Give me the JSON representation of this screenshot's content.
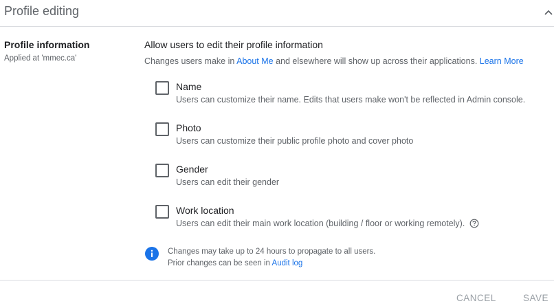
{
  "header": {
    "title": "Profile editing"
  },
  "section": {
    "title": "Profile information",
    "applied": "Applied at 'mmec.ca'"
  },
  "main": {
    "title": "Allow users to edit their profile information",
    "desc_prefix": "Changes users make in ",
    "about_me_link": "About Me",
    "desc_middle": " and elsewhere will show up across their applications. ",
    "learn_more_link": "Learn More"
  },
  "options": [
    {
      "label": "Name",
      "desc": "Users can customize their name. Edits that users make won't be reflected in Admin console.",
      "checked": false
    },
    {
      "label": "Photo",
      "desc": "Users can customize their public profile photo and cover photo",
      "checked": false
    },
    {
      "label": "Gender",
      "desc": "Users can edit their gender",
      "checked": false
    },
    {
      "label": "Work location",
      "desc": "Users can edit their main work location (building / floor or working remotely).",
      "checked": false
    }
  ],
  "info": {
    "line1": "Changes may take up to 24 hours to propagate to all users.",
    "line2_prefix": "Prior changes can be seen in ",
    "audit_link": "Audit log"
  },
  "footer": {
    "cancel_label": "CANCEL",
    "save_label": "SAVE"
  },
  "icons": {
    "collapse": "chevron-up-icon",
    "info": "info-icon",
    "help": "help-circle-icon"
  },
  "colors": {
    "link": "#1a73e8",
    "info_icon": "#1a73e8",
    "disabled_button": "#9aa0a6"
  }
}
